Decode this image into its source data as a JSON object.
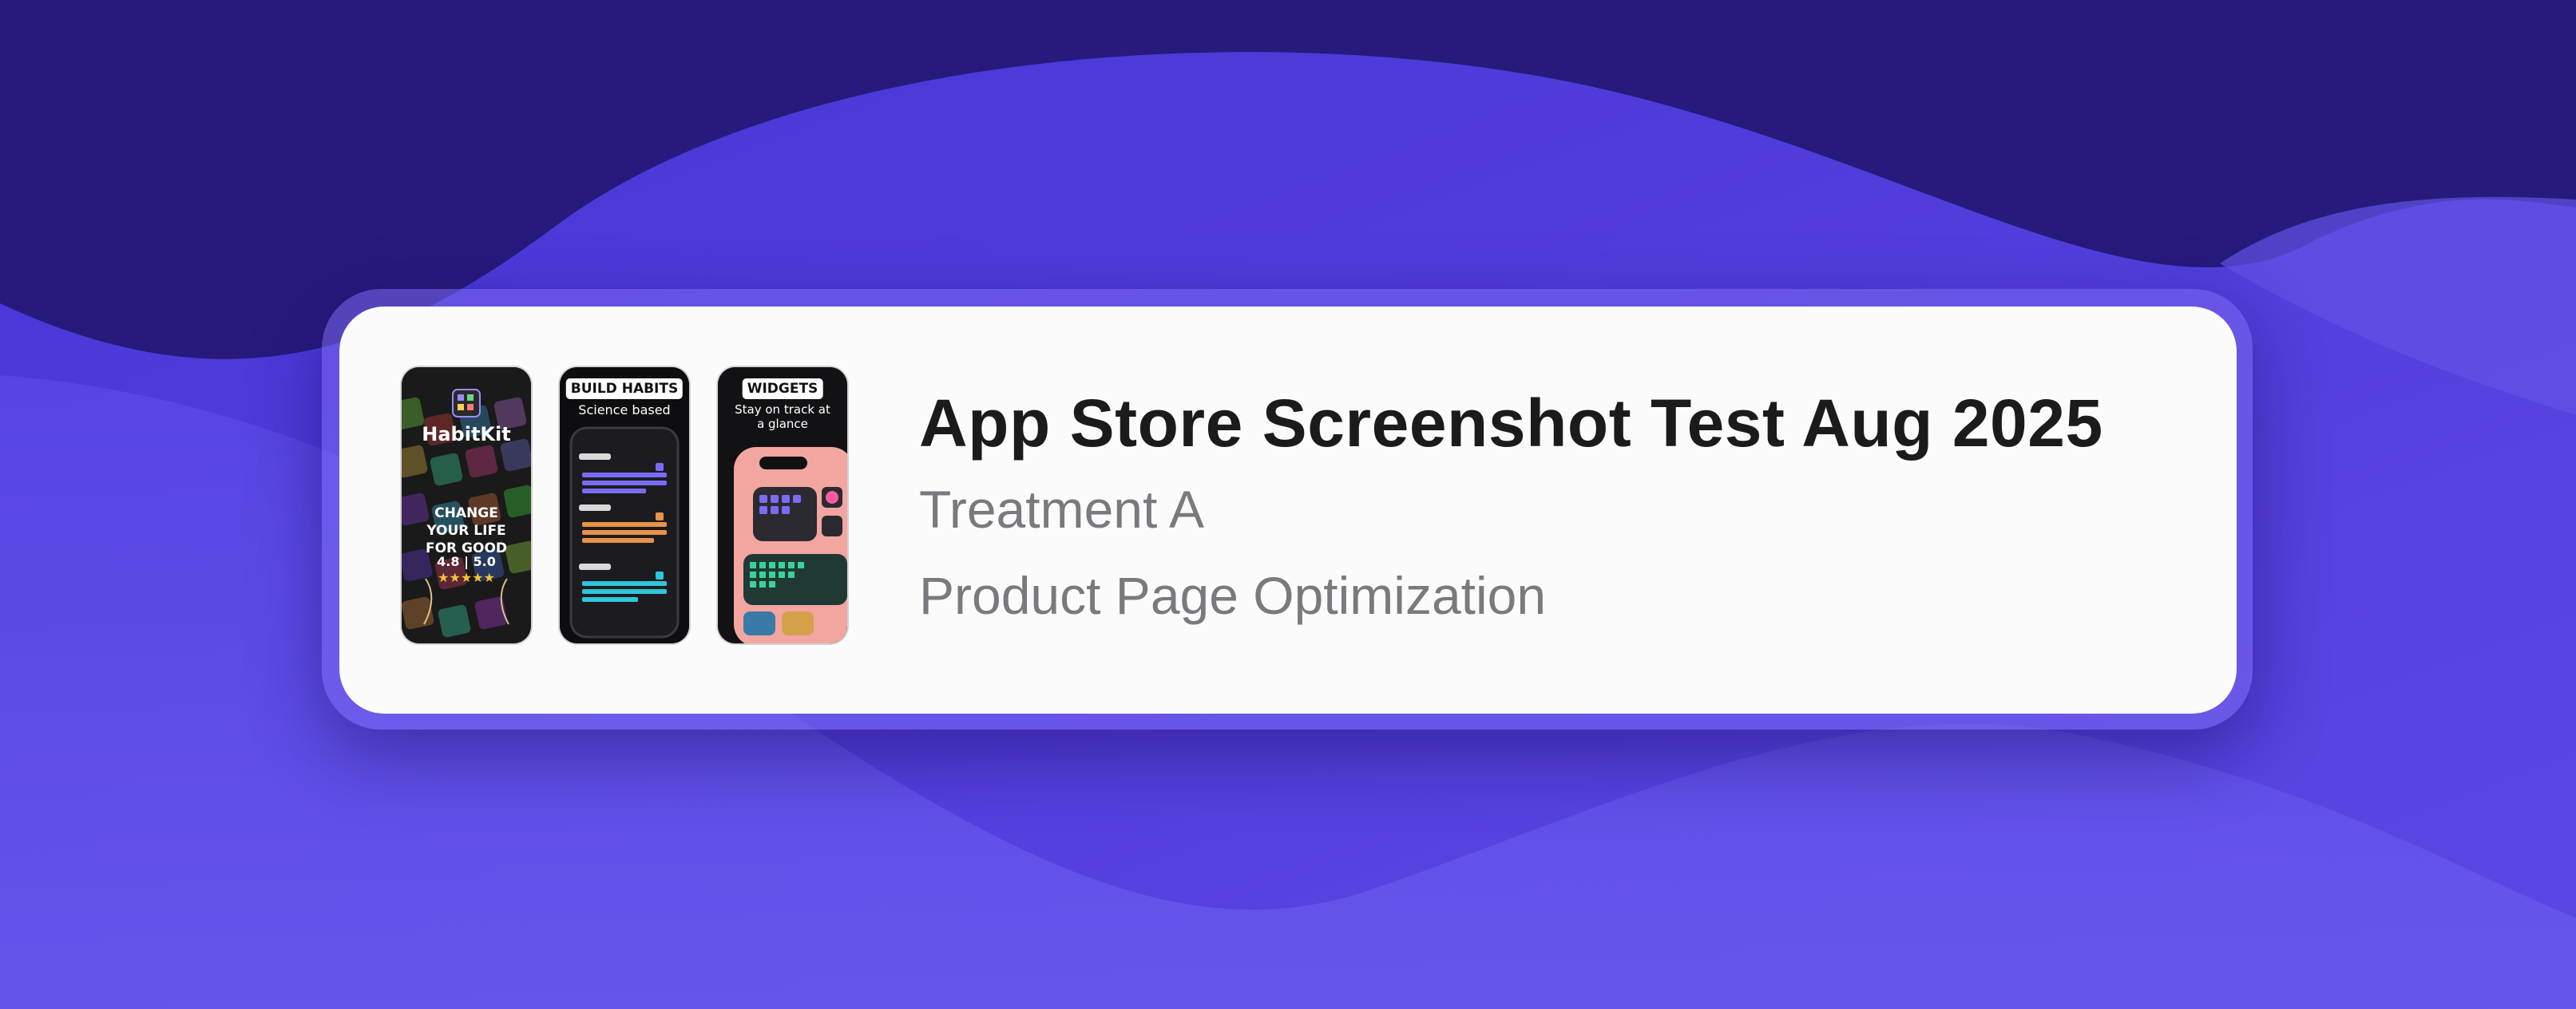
{
  "colors": {
    "background_dark": "#231a78",
    "background_mid": "#4a35d4",
    "background_light": "#6a58e8",
    "card": "#fbfbfb",
    "title": "#1b1b1d",
    "secondary_text": "#7a7a7e"
  },
  "card": {
    "title": "App Store Screenshot Test Aug 2025",
    "treatment": "Treatment A",
    "type": "Product Page Optimization"
  },
  "thumbnails": [
    {
      "brand": "HabitKit",
      "tagline": "CHANGE YOUR LIFE FOR GOOD",
      "rating": "4.8 | 5.0",
      "stars": "★★★★★"
    },
    {
      "badge": "BUILD HABITS",
      "caption": "Science based"
    },
    {
      "badge": "WIDGETS",
      "caption": "Stay on track at a glance"
    }
  ]
}
